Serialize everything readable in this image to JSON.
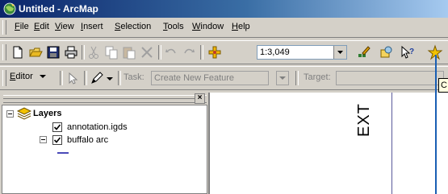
{
  "window": {
    "title": "Untitled - ArcMap"
  },
  "menubar": {
    "items": [
      {
        "pre": "",
        "ul": "F",
        "post": "ile"
      },
      {
        "pre": "",
        "ul": "E",
        "post": "dit"
      },
      {
        "pre": "",
        "ul": "V",
        "post": "iew"
      },
      {
        "pre": "",
        "ul": "I",
        "post": "nsert"
      },
      {
        "pre": "",
        "ul": "S",
        "post": "election"
      },
      {
        "pre": "",
        "ul": "T",
        "post": "ools"
      },
      {
        "pre": "",
        "ul": "W",
        "post": "indow"
      },
      {
        "pre": "",
        "ul": "H",
        "post": "elp"
      }
    ]
  },
  "standard_toolbar": {
    "scale_value": "1:3,049",
    "buttons": [
      "new-icon",
      "open-icon",
      "save-icon",
      "print-icon",
      "cut-icon",
      "copy-icon",
      "paste-icon",
      "delete-icon",
      "undo-icon",
      "redo-icon",
      "add-data-icon",
      "editor-toolbar-icon",
      "arccatalog-icon",
      "whats-this-icon",
      "tool-icon"
    ]
  },
  "editor_toolbar": {
    "editor_pre": "",
    "editor_ul": "E",
    "editor_post": "ditor",
    "task_label": "Task:",
    "task_value": "Create New Feature",
    "target_label": "Target:",
    "target_value": ""
  },
  "toc": {
    "root_label": "Layers",
    "layers": [
      {
        "label": "annotation.igds",
        "checked": true
      },
      {
        "label": "buffalo arc",
        "checked": true
      }
    ],
    "close_glyph": "×"
  },
  "map": {
    "text": "EXT"
  },
  "tooltip": {
    "text": "C"
  },
  "colors": {
    "title_bar": "#0a246a",
    "callout_line": "#1a5fb4",
    "symbol_line": "#4a4ab8"
  }
}
